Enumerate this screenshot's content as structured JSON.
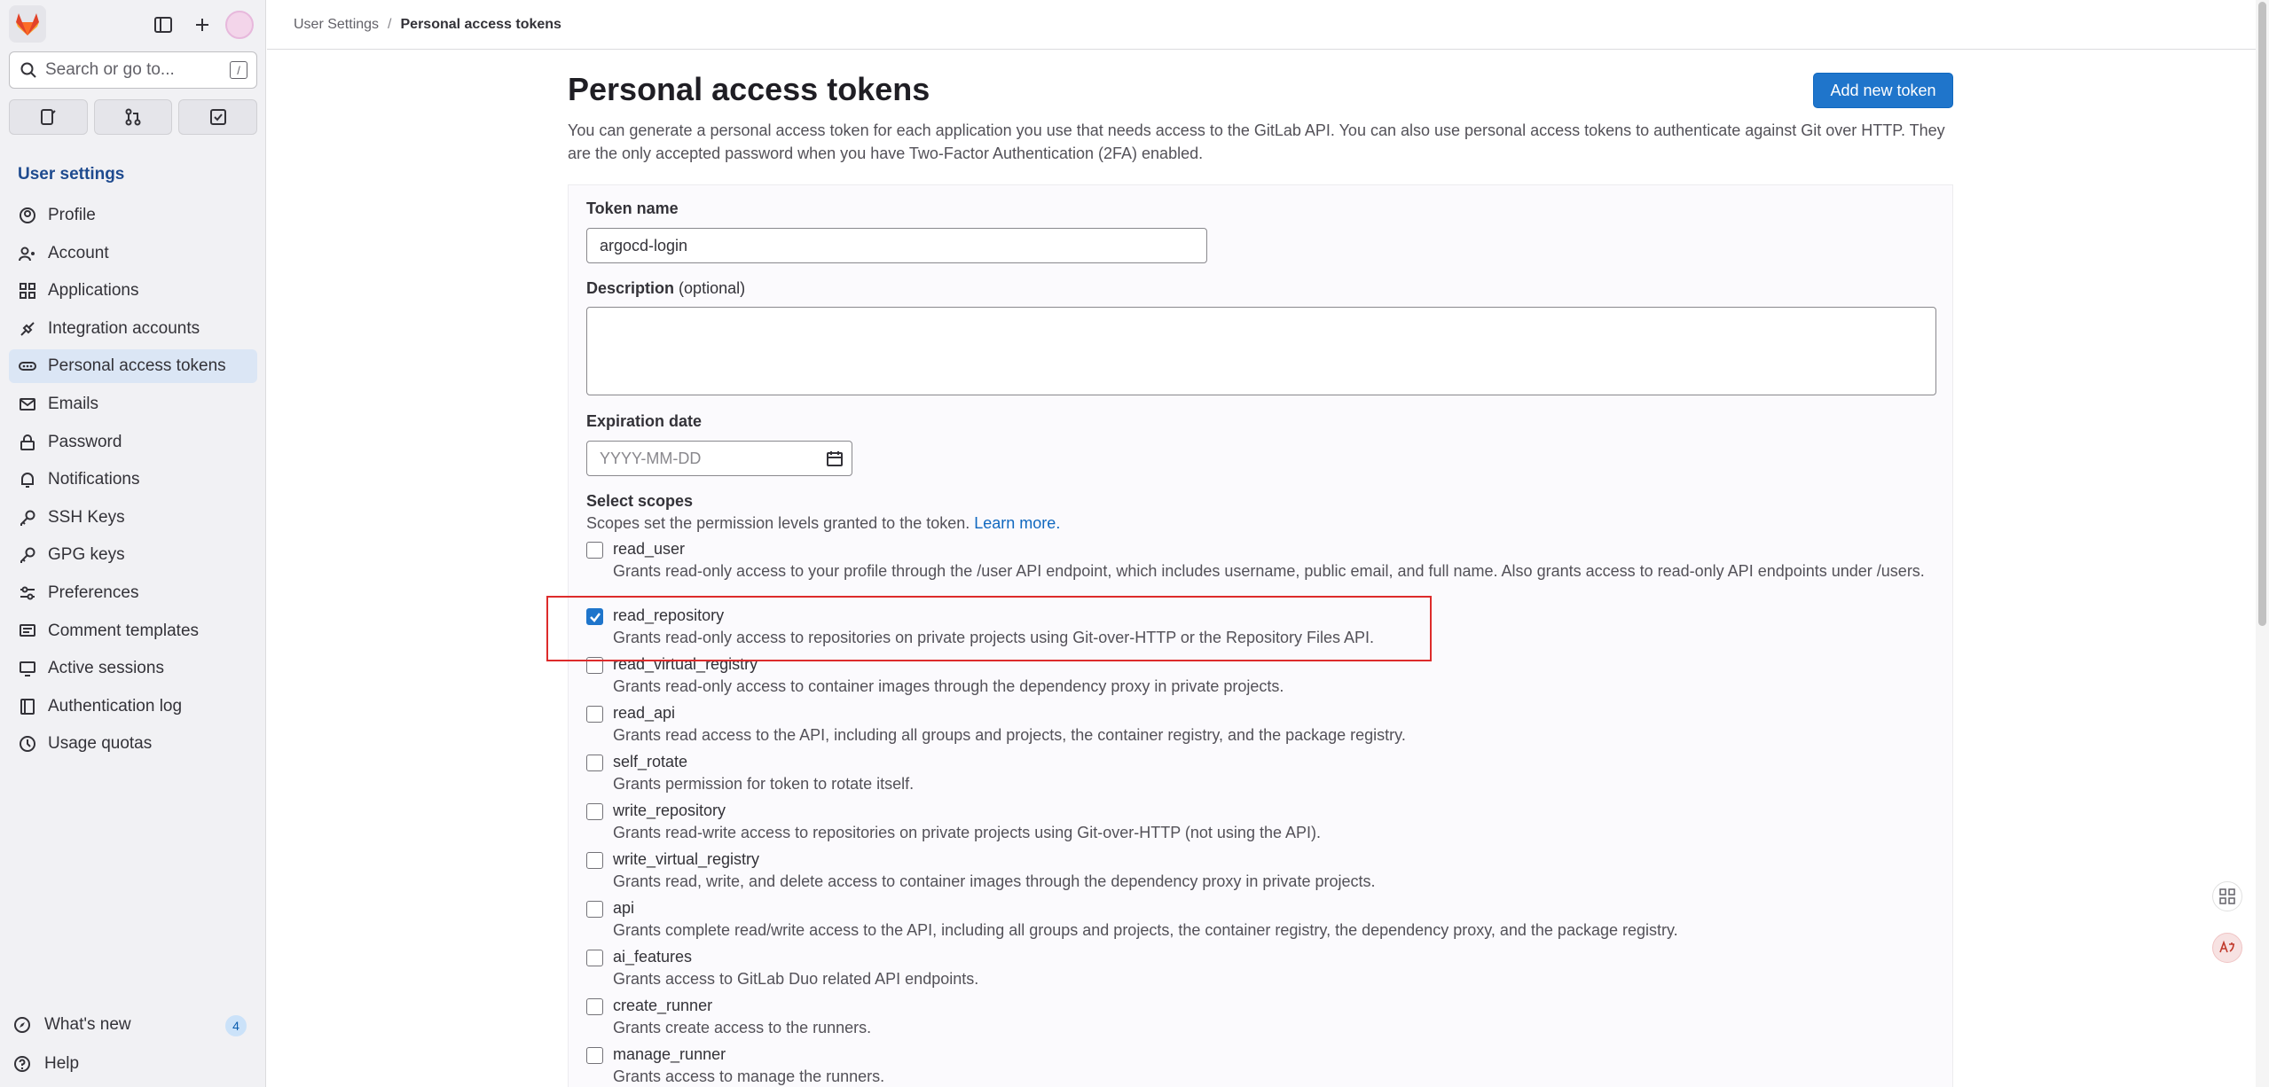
{
  "topbar": {
    "crumb1": "User Settings",
    "sep": "/",
    "crumb2": "Personal access tokens"
  },
  "sidebar": {
    "search_placeholder": "Search or go to...",
    "search_shortcut": "/",
    "section_title": "User settings",
    "items": [
      {
        "label": "Profile",
        "icon": "profile-icon"
      },
      {
        "label": "Account",
        "icon": "account-icon"
      },
      {
        "label": "Applications",
        "icon": "applications-icon"
      },
      {
        "label": "Integration accounts",
        "icon": "integration-icon"
      },
      {
        "label": "Personal access tokens",
        "icon": "token-icon",
        "active": true
      },
      {
        "label": "Emails",
        "icon": "mail-icon"
      },
      {
        "label": "Password",
        "icon": "lock-icon"
      },
      {
        "label": "Notifications",
        "icon": "bell-icon"
      },
      {
        "label": "SSH Keys",
        "icon": "key-icon"
      },
      {
        "label": "GPG keys",
        "icon": "key-icon"
      },
      {
        "label": "Preferences",
        "icon": "preferences-icon"
      },
      {
        "label": "Comment templates",
        "icon": "comment-icon"
      },
      {
        "label": "Active sessions",
        "icon": "monitor-icon"
      },
      {
        "label": "Authentication log",
        "icon": "log-icon"
      },
      {
        "label": "Usage quotas",
        "icon": "quota-icon"
      }
    ],
    "whats_new": "What's new",
    "whats_new_count": "4",
    "help": "Help"
  },
  "main": {
    "title": "Personal access tokens",
    "add_button": "Add new token",
    "intro": "You can generate a personal access token for each application you use that needs access to the GitLab API. You can also use personal access tokens to authenticate against Git over HTTP. They are the only accepted password when you have Two-Factor Authentication (2FA) enabled.",
    "form": {
      "token_name_label": "Token name",
      "token_name_value": "argocd-login",
      "description_label": "Description",
      "description_optional": "(optional)",
      "expiration_label": "Expiration date",
      "expiration_placeholder": "YYYY-MM-DD",
      "scopes_label": "Select scopes",
      "scopes_help": "Scopes set the permission levels granted to the token.",
      "scopes_help_link": "Learn more."
    },
    "scopes": [
      {
        "name": "read_user",
        "checked": false,
        "desc": "Grants read-only access to your profile through the /user API endpoint, which includes username, public email, and full name. Also grants access to read-only API endpoints under /users."
      },
      {
        "name": "read_repository",
        "checked": true,
        "desc": "Grants read-only access to repositories on private projects using Git-over-HTTP or the Repository Files API."
      },
      {
        "name": "read_virtual_registry",
        "checked": false,
        "desc": "Grants read-only access to container images through the dependency proxy in private projects."
      },
      {
        "name": "read_api",
        "checked": false,
        "desc": "Grants read access to the API, including all groups and projects, the container registry, and the package registry."
      },
      {
        "name": "self_rotate",
        "checked": false,
        "desc": "Grants permission for token to rotate itself."
      },
      {
        "name": "write_repository",
        "checked": false,
        "desc": "Grants read-write access to repositories on private projects using Git-over-HTTP (not using the API)."
      },
      {
        "name": "write_virtual_registry",
        "checked": false,
        "desc": "Grants read, write, and delete access to container images through the dependency proxy in private projects."
      },
      {
        "name": "api",
        "checked": false,
        "desc": "Grants complete read/write access to the API, including all groups and projects, the container registry, the dependency proxy, and the package registry."
      },
      {
        "name": "ai_features",
        "checked": false,
        "desc": "Grants access to GitLab Duo related API endpoints."
      },
      {
        "name": "create_runner",
        "checked": false,
        "desc": "Grants create access to the runners."
      },
      {
        "name": "manage_runner",
        "checked": false,
        "desc": "Grants access to manage the runners."
      }
    ]
  },
  "colors": {
    "accent": "#1f75cb",
    "sidebar_bg": "#f1f1f4",
    "active_item": "#dbe6f5",
    "highlight": "#dd2b2b"
  }
}
